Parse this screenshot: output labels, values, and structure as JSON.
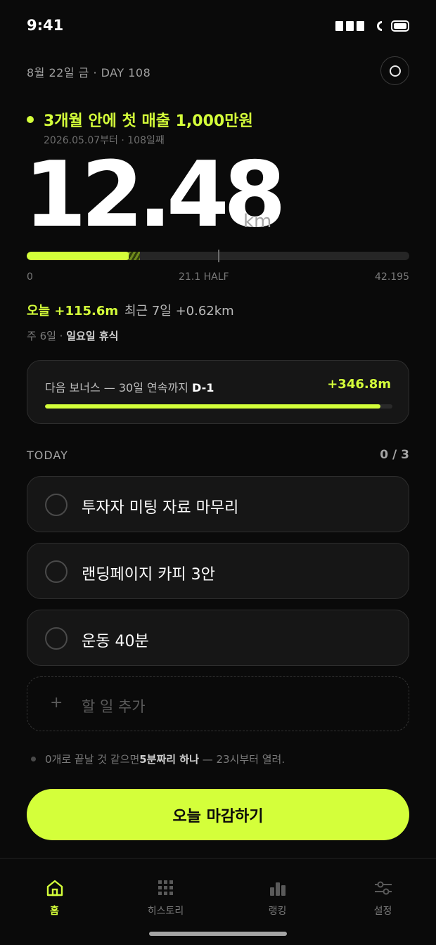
{
  "status_bar": {
    "time": "9:41"
  },
  "header": {
    "date": "8월 22일 금 · DAY 108"
  },
  "goal": {
    "title": "3개월 안에 첫 매출 1,000만원",
    "subtitle": "2026.05.07부터 · 108일째"
  },
  "distance": {
    "value": "12.48",
    "unit": "km",
    "progress_km": 12.48,
    "total_km": 42.195,
    "scale": {
      "start": "0",
      "mid": "21.1 HALF",
      "end": "42.195"
    }
  },
  "stats": {
    "today": "오늘 +115.6m",
    "recent": "최근 7일 +0.62km",
    "rest_prefix": "주 6일 · ",
    "rest_day": "일요일 휴식"
  },
  "bonus": {
    "label": "다음 보너스 — 30일 연속까지 ",
    "countdown": "D-1",
    "amount": "+346.8m",
    "progress_fraction": 0.965
  },
  "today_section": {
    "title": "TODAY",
    "count": "0 / 3",
    "tasks": [
      {
        "label": "투자자 미팅 자료 마무리"
      },
      {
        "label": "랜딩페이지 카피 3안"
      },
      {
        "label": "운동 40분"
      }
    ],
    "add_placeholder": "할 일 추가"
  },
  "tip": {
    "prefix": "0개로 끝날 것 같으면 ",
    "bold": "5분짜리 하나",
    "suffix": " — 23시부터 열려."
  },
  "primary_action": {
    "label": "오늘 마감하기"
  },
  "tabs": [
    {
      "label": "홈",
      "icon": "home-icon",
      "active": true
    },
    {
      "label": "히스토리",
      "icon": "grid-icon",
      "active": false
    },
    {
      "label": "랭킹",
      "icon": "bar-chart-icon",
      "active": false
    },
    {
      "label": "설정",
      "icon": "sliders-icon",
      "active": false
    }
  ],
  "colors": {
    "accent": "#d4ff3a",
    "background": "#0a0a0a",
    "card": "#161616"
  }
}
